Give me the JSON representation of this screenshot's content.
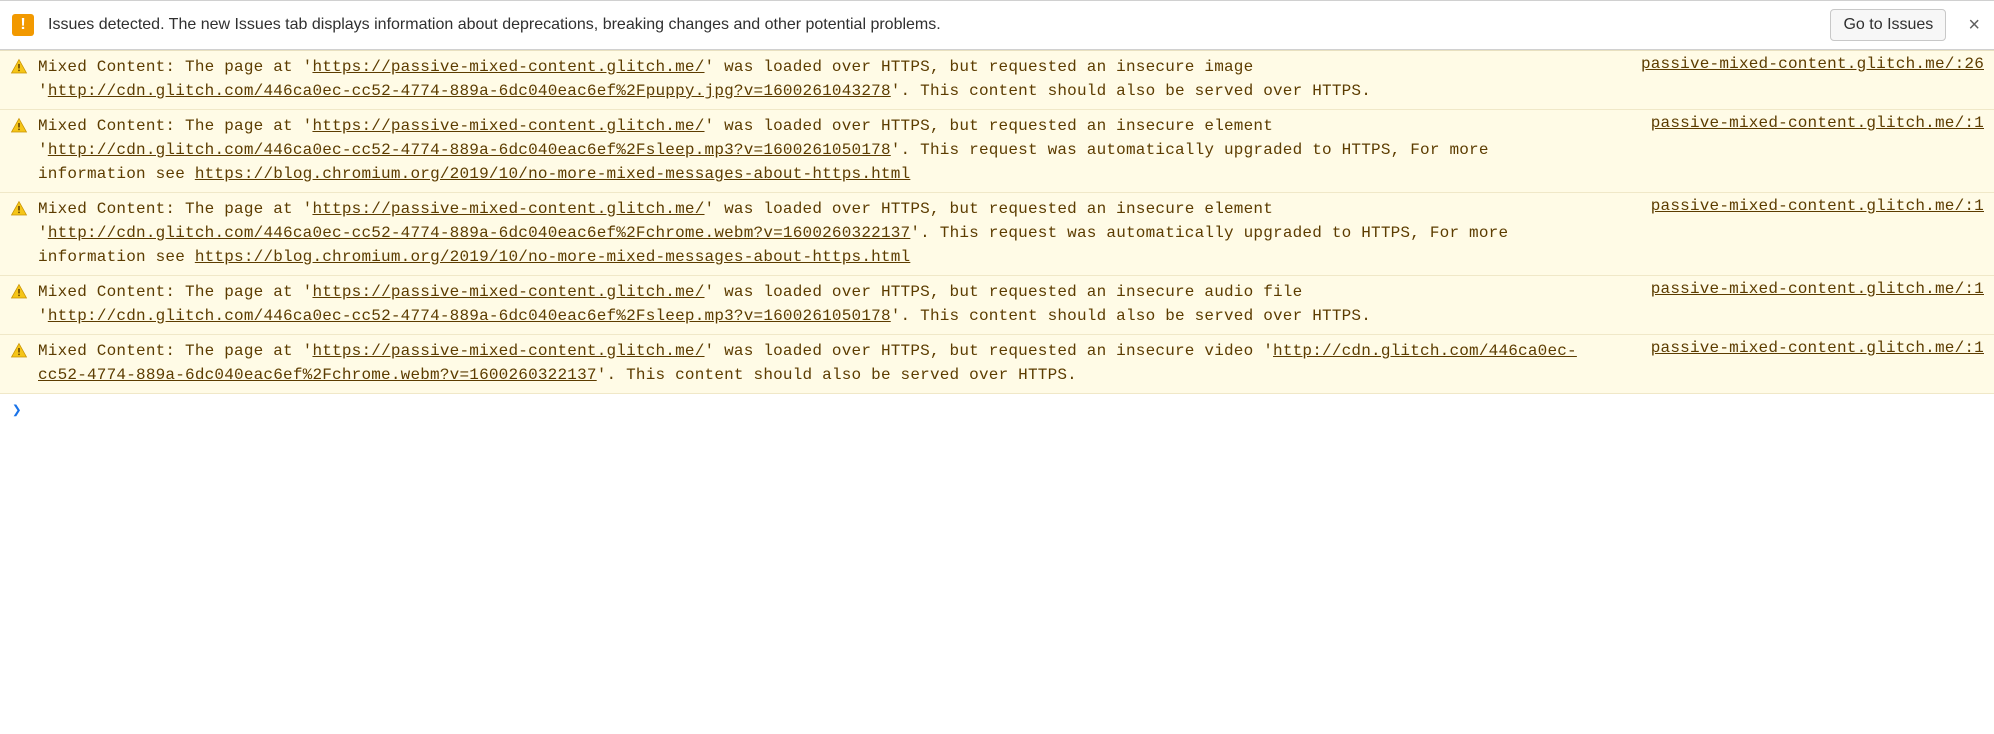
{
  "issues_bar": {
    "text": "Issues detected. The new Issues tab displays information about deprecations, breaking changes and other potential problems.",
    "button": "Go to Issues",
    "close": "×",
    "icon_glyph": "!"
  },
  "page_url": "https://passive-mixed-content.glitch.me/",
  "chromium_blog": "https://blog.chromium.org/2019/10/no-more-mixed-messages-about-https.html",
  "messages": [
    {
      "prefix": "Mixed Content: The page at '",
      "page_url": "https://passive-mixed-content.glitch.me/",
      "mid1": "' was loaded over HTTPS, but requested an insecure image '",
      "resource": "http://cdn.glitch.com/446ca0ec-cc52-4774-889a-6dc040eac6ef%2Fpuppy.jpg?v=1600261043278",
      "tail": "'. This content should also be served over HTTPS.",
      "has_blog": false,
      "source": "passive-mixed-content.glitch.me/:26"
    },
    {
      "prefix": "Mixed Content: The page at '",
      "page_url": "https://passive-mixed-content.glitch.me/",
      "mid1": "' was loaded over HTTPS, but requested an insecure element '",
      "resource": "http://cdn.glitch.com/446ca0ec-cc52-4774-889a-6dc040eac6ef%2Fsleep.mp3?v=1600261050178",
      "tail": "'. This request was automatically upgraded to HTTPS, For more information see ",
      "has_blog": true,
      "blog": "https://blog.chromium.org/2019/10/no-more-mixed-messages-about-https.html",
      "source": "passive-mixed-content.glitch.me/:1"
    },
    {
      "prefix": "Mixed Content: The page at '",
      "page_url": "https://passive-mixed-content.glitch.me/",
      "mid1": "' was loaded over HTTPS, but requested an insecure element '",
      "resource": "http://cdn.glitch.com/446ca0ec-cc52-4774-889a-6dc040eac6ef%2Fchrome.webm?v=1600260322137",
      "tail": "'. This request was automatically upgraded to HTTPS, For more information see ",
      "has_blog": true,
      "blog": "https://blog.chromium.org/2019/10/no-more-mixed-messages-about-https.html",
      "source": "passive-mixed-content.glitch.me/:1"
    },
    {
      "prefix": "Mixed Content: The page at '",
      "page_url": "https://passive-mixed-content.glitch.me/",
      "mid1": "' was loaded over HTTPS, but requested an insecure audio file '",
      "resource": "http://cdn.glitch.com/446ca0ec-cc52-4774-889a-6dc040eac6ef%2Fsleep.mp3?v=1600261050178",
      "tail": "'. This content should also be served over HTTPS.",
      "has_blog": false,
      "source": "passive-mixed-content.glitch.me/:1"
    },
    {
      "prefix": "Mixed Content: The page at '",
      "page_url": "https://passive-mixed-content.glitch.me/",
      "mid1": "' was loaded over HTTPS, but requested an insecure video '",
      "resource": "http://cdn.glitch.com/446ca0ec-cc52-4774-889a-6dc040eac6ef%2Fchrome.webm?v=1600260322137",
      "tail": "'. This content should also be served over HTTPS.",
      "has_blog": false,
      "source": "passive-mixed-content.glitch.me/:1"
    }
  ],
  "prompt": "❯"
}
